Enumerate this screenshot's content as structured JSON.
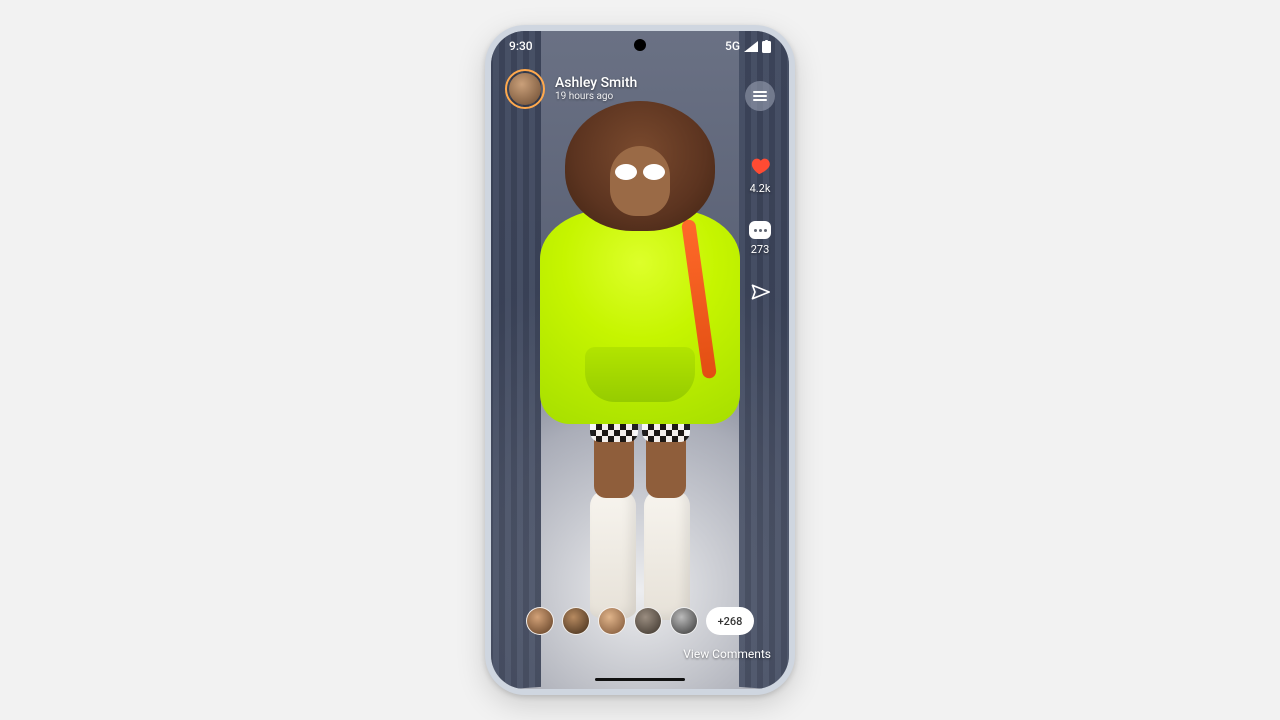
{
  "status_bar": {
    "time": "9:30",
    "network_label": "5G"
  },
  "post": {
    "author_name": "Ashley Smith",
    "posted_ago": "19 hours ago"
  },
  "side_rail": {
    "menu_icon": "menu-icon",
    "like_count": "4.2k",
    "comment_count": "273",
    "share_icon": "send-icon"
  },
  "bottom": {
    "more_count_label": "+268",
    "view_comments_label": "View Comments",
    "viewer_avatar_count": 5
  },
  "colors": {
    "accent_like": "#ff4b33",
    "avatar_ring": "#ffa94d",
    "hoodie": "#c6f500"
  }
}
